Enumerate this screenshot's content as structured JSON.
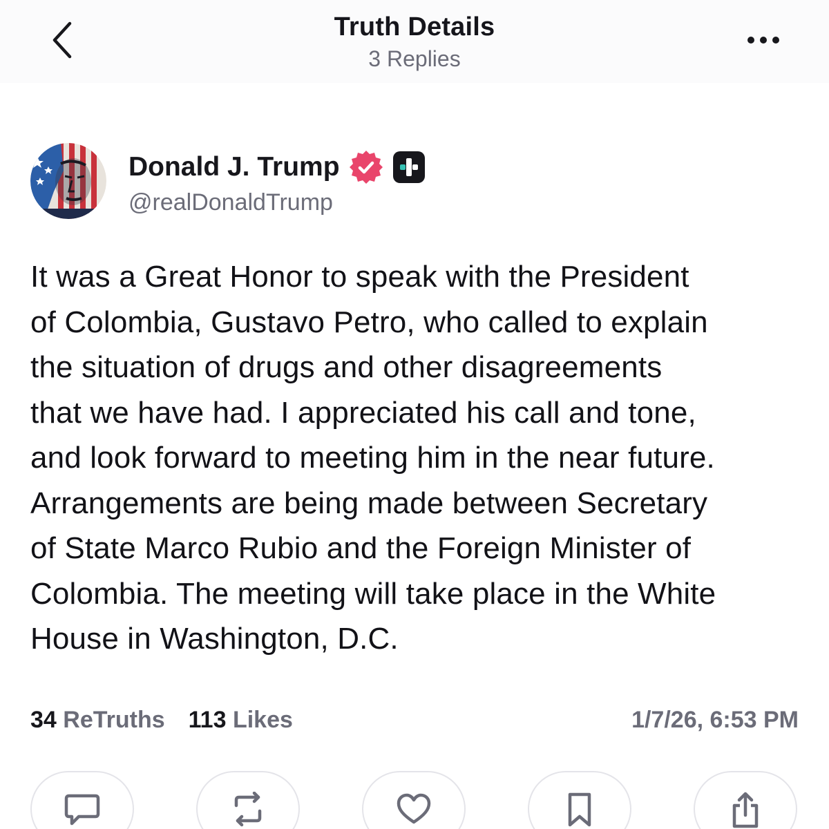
{
  "header": {
    "title": "Truth Details",
    "subtitle": "3 Replies"
  },
  "author": {
    "name": "Donald J. Trump",
    "handle": "@realDonaldTrump",
    "verified_color": "#e9456b"
  },
  "post": {
    "lines": [
      "It was a Great Honor to speak with the President",
      "of Colombia, Gustavo Petro, who called to explain",
      "the situation of drugs and other disagreements",
      "that we have had. I appreciated his call and tone,",
      "and look forward to meeting him in the near future.",
      "Arrangements are being made between Secretary",
      "of State Marco Rubio and the Foreign Minister of",
      "Colombia. The meeting will take place in the White",
      "House in Washington, D.C."
    ]
  },
  "stats": {
    "retruths_count": "34",
    "retruths_label": "ReTruths",
    "likes_count": "113",
    "likes_label": "Likes",
    "timestamp": "1/7/26, 6:53 PM"
  },
  "actions": [
    {
      "icon": "reply-icon"
    },
    {
      "icon": "retruth-icon"
    },
    {
      "icon": "like-icon"
    },
    {
      "icon": "bookmark-icon"
    },
    {
      "icon": "share-icon"
    }
  ],
  "colors": {
    "text": "#121217",
    "muted": "#6b6c78",
    "verified": "#e9456b",
    "border": "#e4e4e9"
  }
}
